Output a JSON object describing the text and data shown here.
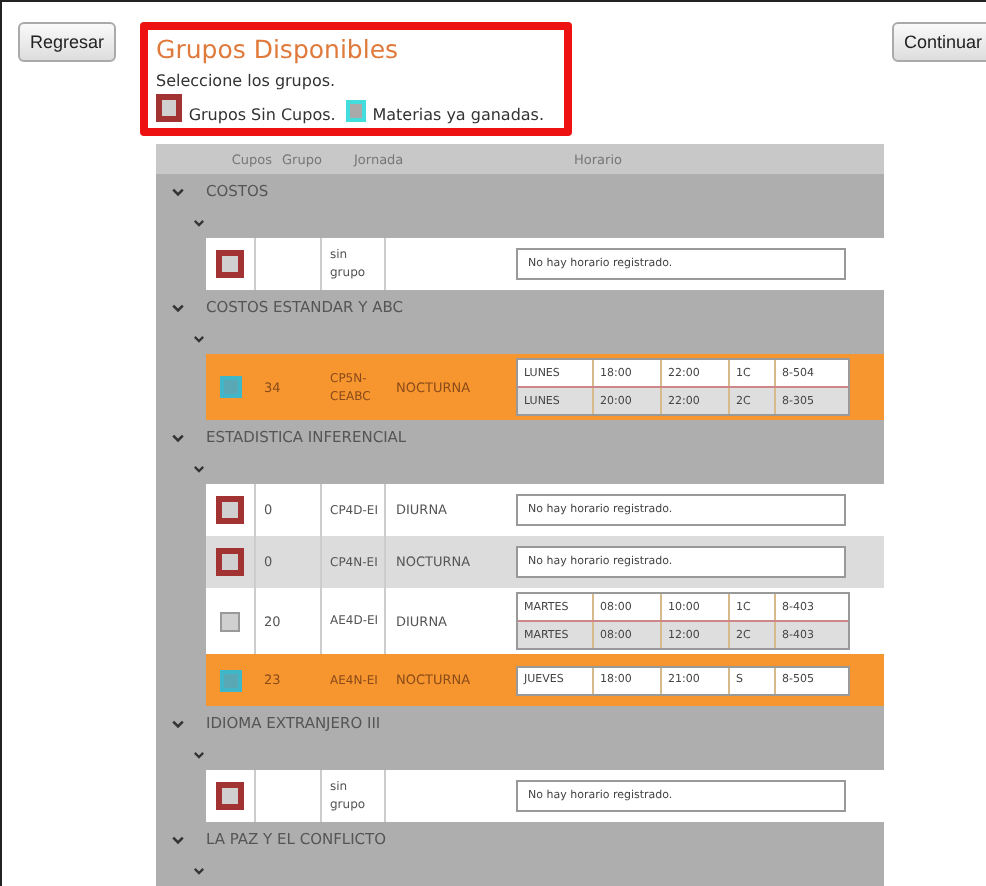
{
  "buttons": {
    "back": "Regresar",
    "next": "Continuar"
  },
  "header": {
    "title": "Grupos Disponibles",
    "instruction": "Seleccione los grupos.",
    "legend": [
      {
        "kind": "sin_cupos",
        "label": "Grupos Sin Cupos."
      },
      {
        "kind": "ganada",
        "label": "Materias ya ganadas."
      }
    ]
  },
  "table": {
    "columns": [
      "Cupos",
      "Grupo",
      "Jornada",
      "Horario"
    ],
    "groups": [
      {
        "name": "COSTOS",
        "expanded": true,
        "rows": [
          {
            "kind": "sin_cupos",
            "cupos": "",
            "grupo": "sin grupo",
            "jornada": "",
            "horario_text": "No hay horario registrado."
          }
        ]
      },
      {
        "name": "COSTOS ESTANDAR Y ABC",
        "expanded": true,
        "rows": [
          {
            "kind": "ganada",
            "cupos": "34",
            "grupo": "CP5N-CEABC",
            "jornada": "NOCTURNA",
            "schedule": [
              [
                "LUNES",
                "18:00",
                "22:00",
                "1C",
                "8-504"
              ],
              [
                "LUNES",
                "20:00",
                "22:00",
                "2C",
                "8-305"
              ]
            ]
          }
        ]
      },
      {
        "name": "ESTADISTICA INFERENCIAL",
        "expanded": true,
        "rows": [
          {
            "kind": "sin_cupos",
            "cupos": "0",
            "grupo": "CP4D-EI",
            "jornada": "DIURNA",
            "horario_text": "No hay horario registrado."
          },
          {
            "kind": "sin_cupos",
            "cupos": "0",
            "grupo": "CP4N-EI",
            "jornada": "NOCTURNA",
            "horario_text": "No hay horario registrado."
          },
          {
            "kind": "disponible",
            "cupos": "20",
            "grupo": "AE4D-EI",
            "jornada": "DIURNA",
            "schedule": [
              [
                "MARTES",
                "08:00",
                "10:00",
                "1C",
                "8-403"
              ],
              [
                "MARTES",
                "08:00",
                "12:00",
                "2C",
                "8-403"
              ]
            ]
          },
          {
            "kind": "ganada",
            "cupos": "23",
            "grupo": "AE4N-EI",
            "jornada": "NOCTURNA",
            "schedule": [
              [
                "JUEVES",
                "18:00",
                "21:00",
                "S",
                "8-505"
              ]
            ]
          }
        ]
      },
      {
        "name": "IDIOMA EXTRANJERO III",
        "expanded": true,
        "rows": [
          {
            "kind": "sin_cupos",
            "cupos": "",
            "grupo": "sin grupo",
            "jornada": "",
            "horario_text": "No hay horario registrado."
          }
        ]
      },
      {
        "name": "LA PAZ Y EL CONFLICTO",
        "expanded": true
      }
    ]
  }
}
